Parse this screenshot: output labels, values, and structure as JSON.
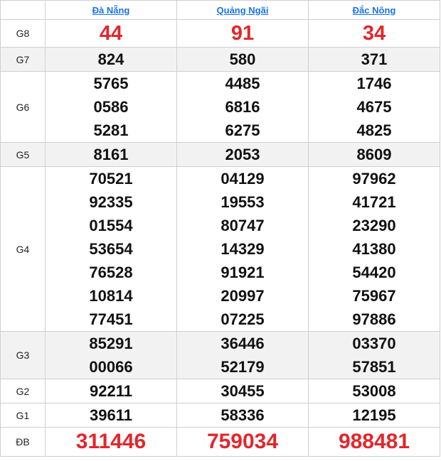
{
  "provinces": [
    "Đà Nẵng",
    "Quảng Ngãi",
    "Đắc Nông"
  ],
  "rows": [
    {
      "label": "G8",
      "shade": false,
      "style": "g8",
      "values": [
        [
          "44"
        ],
        [
          "91"
        ],
        [
          "34"
        ]
      ]
    },
    {
      "label": "G7",
      "shade": true,
      "style": "normal",
      "values": [
        [
          "824"
        ],
        [
          "580"
        ],
        [
          "371"
        ]
      ]
    },
    {
      "label": "G6",
      "shade": false,
      "style": "normal",
      "values": [
        [
          "5765",
          "0586",
          "5281"
        ],
        [
          "4485",
          "6816",
          "6275"
        ],
        [
          "1746",
          "4675",
          "4825"
        ]
      ]
    },
    {
      "label": "G5",
      "shade": true,
      "style": "normal",
      "values": [
        [
          "8161"
        ],
        [
          "2053"
        ],
        [
          "8609"
        ]
      ]
    },
    {
      "label": "G4",
      "shade": false,
      "style": "normal",
      "values": [
        [
          "70521",
          "92335",
          "01554",
          "53654",
          "76528",
          "10814",
          "77451"
        ],
        [
          "04129",
          "19553",
          "80747",
          "14329",
          "91921",
          "20997",
          "07225"
        ],
        [
          "97962",
          "41721",
          "23290",
          "41380",
          "54420",
          "75967",
          "97886"
        ]
      ]
    },
    {
      "label": "G3",
      "shade": true,
      "style": "normal",
      "values": [
        [
          "85291",
          "00066"
        ],
        [
          "36446",
          "52179"
        ],
        [
          "03370",
          "57851"
        ]
      ]
    },
    {
      "label": "G2",
      "shade": false,
      "style": "normal",
      "values": [
        [
          "92211"
        ],
        [
          "30455"
        ],
        [
          "53008"
        ]
      ]
    },
    {
      "label": "G1",
      "shade": false,
      "style": "normal",
      "values": [
        [
          "39611"
        ],
        [
          "58336"
        ],
        [
          "12195"
        ]
      ]
    },
    {
      "label": "ĐB",
      "shade": false,
      "style": "big",
      "values": [
        [
          "311446"
        ],
        [
          "759034"
        ],
        [
          "988481"
        ]
      ]
    }
  ],
  "colors": {
    "special": "#e3262b",
    "link": "#1a73e8",
    "shade": "#f2f2f2"
  }
}
